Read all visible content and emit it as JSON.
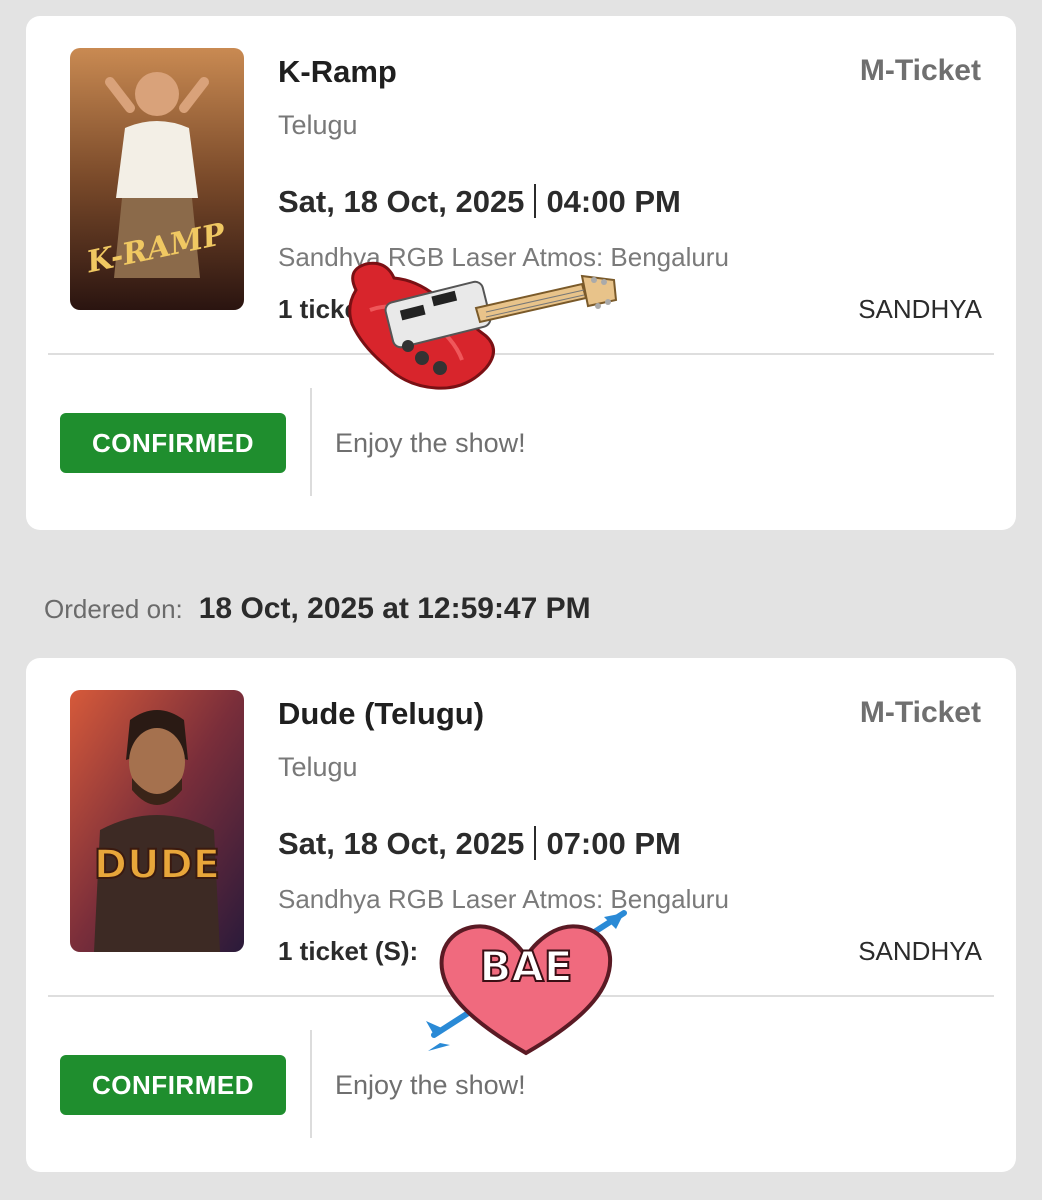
{
  "bookings": [
    {
      "title": "K-Ramp",
      "ticket_type": "M-Ticket",
      "language": "Telugu",
      "date": "Sat, 18 Oct, 2025",
      "time": "04:00 PM",
      "venue": "Sandhya RGB Laser Atmos: Bengaluru",
      "tickets": "1 ticket (S):",
      "screen": "SANDHYA",
      "status": "CONFIRMED",
      "message": "Enjoy the show!",
      "poster_text": "K-RAMP"
    },
    {
      "title": "Dude (Telugu)",
      "ticket_type": "M-Ticket",
      "language": "Telugu",
      "date": "Sat, 18 Oct, 2025",
      "time": "07:00 PM",
      "venue": "Sandhya RGB Laser Atmos: Bengaluru",
      "tickets": "1 ticket (S):",
      "screen": "SANDHYA",
      "status": "CONFIRMED",
      "message": "Enjoy the show!",
      "poster_text": "DUDE"
    }
  ],
  "order_info": {
    "label": "Ordered on:",
    "value": "18 Oct, 2025 at 12:59:47 PM"
  },
  "stickers": {
    "heart_text": "BAE"
  },
  "colors": {
    "background": "#e3e3e3",
    "card": "#ffffff",
    "confirmed_green": "#1f8e2e"
  }
}
